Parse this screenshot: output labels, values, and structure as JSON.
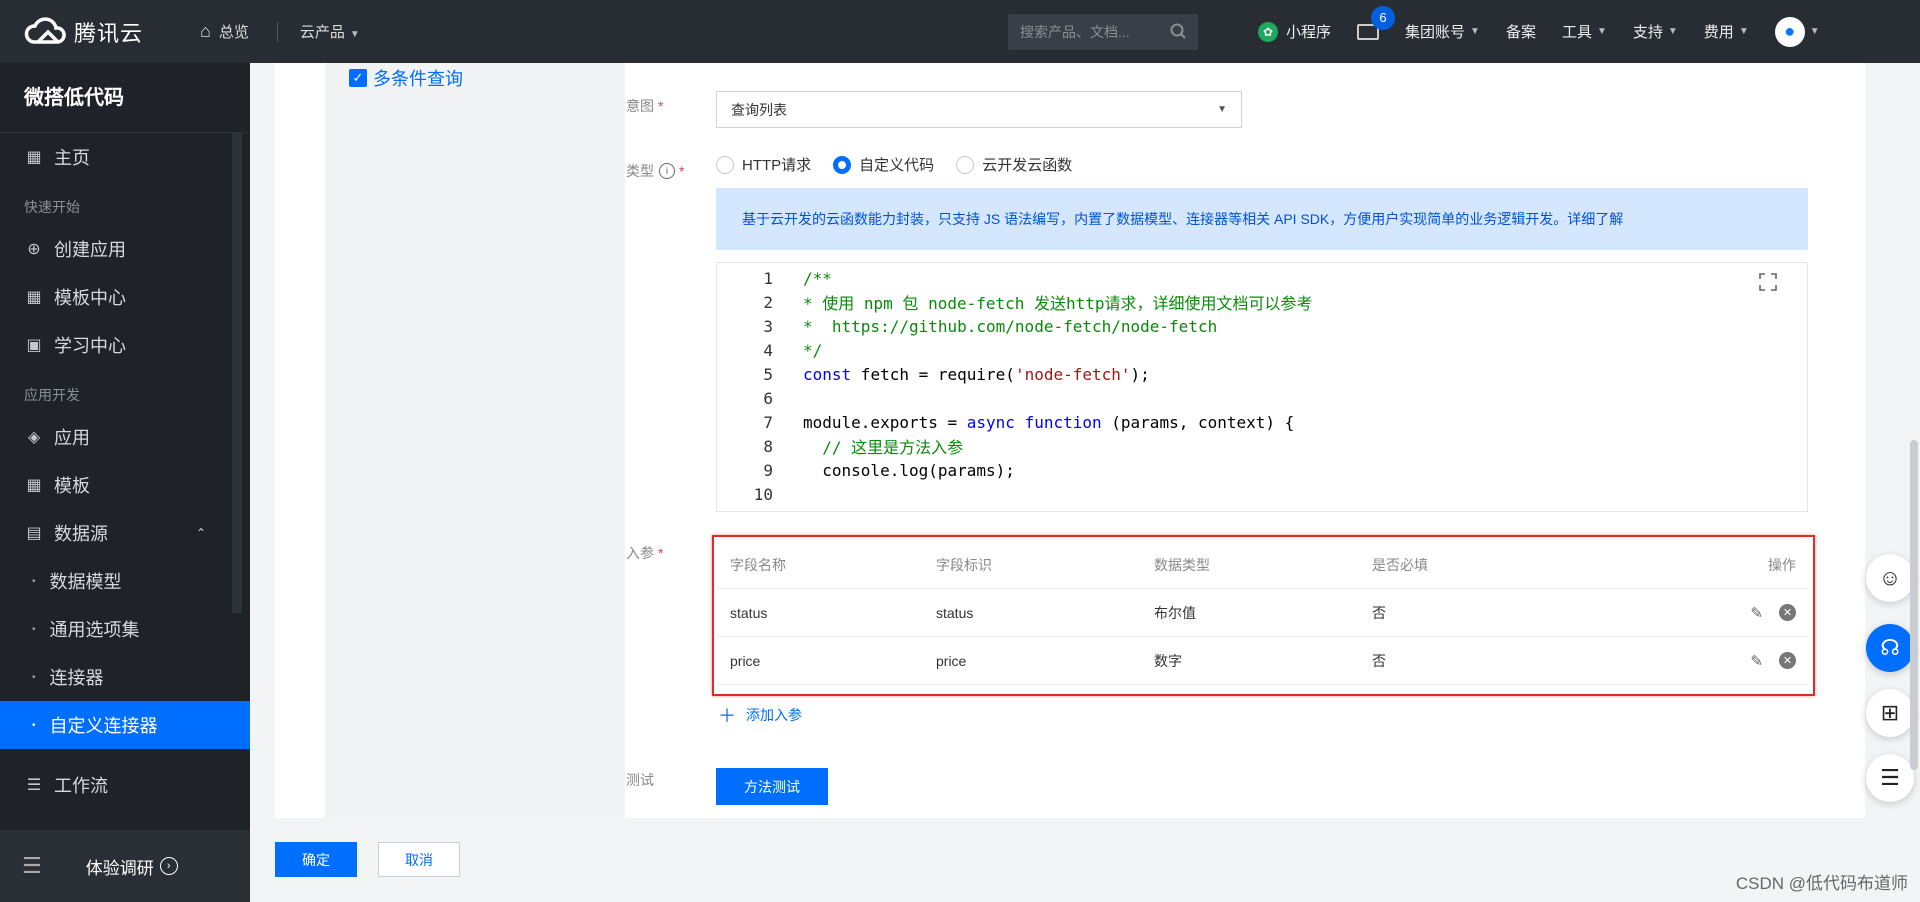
{
  "topbar": {
    "brand": "腾讯云",
    "home": "总览",
    "products": "云产品",
    "search_placeholder": "搜索产品、文档...",
    "mini_program": "小程序",
    "mail_badge": "6",
    "account": "集团账号",
    "filing": "备案",
    "tools": "工具",
    "support": "支持",
    "billing": "费用"
  },
  "sidebar": {
    "title": "微搭低代码",
    "home": "主页",
    "group_quick": "快速开始",
    "create_app": "创建应用",
    "template_center": "模板中心",
    "learn_center": "学习中心",
    "group_dev": "应用开发",
    "apps": "应用",
    "templates": "模板",
    "datasource": "数据源",
    "sub_items": [
      "数据模型",
      "通用选项集",
      "连接器",
      "自定义连接器"
    ],
    "workflow": "工作流",
    "bottom": "体验调研"
  },
  "form": {
    "method_checkbox": "多条件查询",
    "intent_label": "意图",
    "intent_value": "查询列表",
    "type_label": "类型",
    "type_options": [
      "HTTP请求",
      "自定义代码",
      "云开发云函数"
    ],
    "type_selected": "自定义代码",
    "info_text": "基于云开发的云函数能力封装，只支持 JS 语法编写，内置了数据模型、连接器等相关 API SDK，方便用户实现简单的业务逻辑开发。详细了解",
    "params_label": "入参",
    "test_label": "测试",
    "add_param": "添加入参",
    "test_button": "方法测试",
    "ok_button": "确定",
    "cancel_button": "取消"
  },
  "code_lines": [
    "/**",
    "* 使用 npm 包 node-fetch 发送http请求，详细使用文档可以参考",
    "*  https://github.com/node-fetch/node-fetch",
    "*/",
    "const fetch = require('node-fetch');",
    "",
    "module.exports = async function (params, context) {",
    "  // 这里是方法入参",
    "  console.log(params);",
    "",
    "/**"
  ],
  "params_table": {
    "headers": [
      "字段名称",
      "字段标识",
      "数据类型",
      "是否必填",
      "操作"
    ],
    "rows": [
      [
        "status",
        "status",
        "布尔值",
        "否"
      ],
      [
        "price",
        "price",
        "数字",
        "否"
      ]
    ]
  },
  "watermark": "CSDN @低代码布道师"
}
